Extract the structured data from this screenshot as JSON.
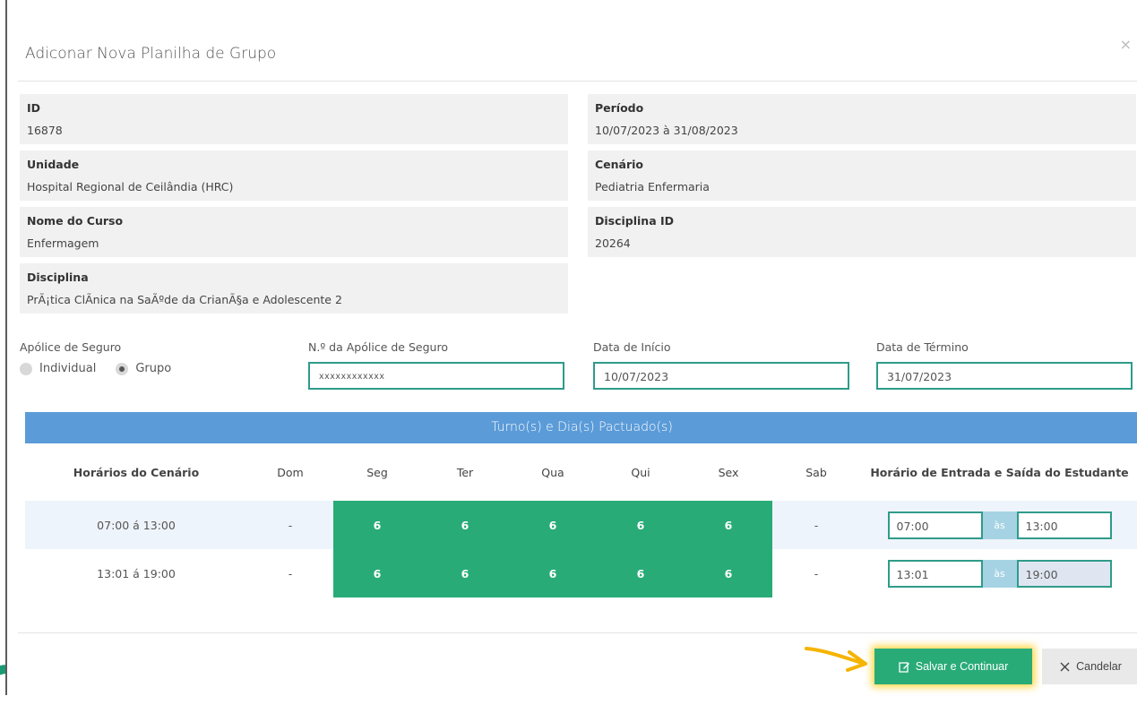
{
  "modal": {
    "title": "Adiconar Nova Planilha de Grupo",
    "close": "×"
  },
  "info": {
    "id_label": "ID",
    "id_value": "16878",
    "periodo_label": "Período",
    "periodo_value": "10/07/2023 à 31/08/2023",
    "unidade_label": "Unidade",
    "unidade_value": "Hospital Regional de Ceilândia (HRC)",
    "cenario_label": "Cenário",
    "cenario_value": "Pediatria Enfermaria",
    "curso_label": "Nome do Curso",
    "curso_value": "Enfermagem",
    "disciplina_id_label": "Disciplina ID",
    "disciplina_id_value": "20264",
    "disciplina_label": "Disciplina",
    "disciplina_value": "PrÃ¡tica ClÃ­nica na SaÃºde da CrianÃ§a e Adolescente 2"
  },
  "form": {
    "apolice_label": "Apólice de Seguro",
    "radio_individual": "Individual",
    "radio_grupo": "Grupo",
    "selected": "Grupo",
    "numero_label": "N.º da Apólice de Seguro",
    "numero_value": "xxxxxxxxxxxx",
    "inicio_label": "Data de Início",
    "inicio_value": "10/07/2023",
    "termino_label": "Data de Término",
    "termino_value": "31/07/2023"
  },
  "schedule": {
    "banner": "Turno(s) e Dia(s) Pactuado(s)",
    "headers": {
      "horarios": "Horários do Cenário",
      "dom": "Dom",
      "seg": "Seg",
      "ter": "Ter",
      "qua": "Qua",
      "qui": "Qui",
      "sex": "Sex",
      "sab": "Sab",
      "entrada_saida": "Horário de Entrada e Saída do Estudante"
    },
    "rows": [
      {
        "horario": "07:00 á 13:00",
        "dom": "-",
        "seg": "6",
        "ter": "6",
        "qua": "6",
        "qui": "6",
        "sex": "6",
        "sab": "-",
        "entrada": "07:00",
        "as": "às",
        "saida": "13:00"
      },
      {
        "horario": "13:01 á 19:00",
        "dom": "-",
        "seg": "6",
        "ter": "6",
        "qua": "6",
        "qui": "6",
        "sex": "6",
        "sab": "-",
        "entrada": "13:01",
        "as": "às",
        "saida": "19:00"
      }
    ]
  },
  "footer": {
    "save_label": "Salvar e Continuar",
    "cancel_label": "Candelar"
  },
  "colors": {
    "accent_green": "#29ab78",
    "banner_blue": "#5b9bd8",
    "input_border": "#2f9b8a"
  }
}
